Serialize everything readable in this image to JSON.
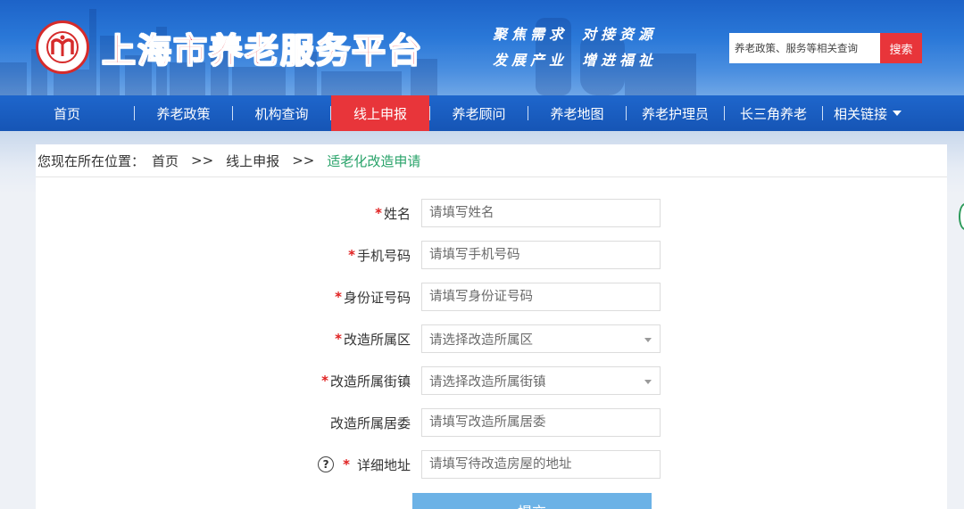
{
  "header": {
    "site_title": "上海市养老服务平台",
    "slogan_line1": [
      "聚焦需求",
      "对接资源"
    ],
    "slogan_line2": [
      "发展产业",
      "增进福祉"
    ],
    "search_placeholder": "养老政策、服务等相关查询",
    "search_button": "搜索",
    "brand_color": "#e8222b"
  },
  "nav": {
    "items": [
      {
        "label": "首页",
        "active": false
      },
      {
        "label": "养老政策",
        "active": false
      },
      {
        "label": "机构查询",
        "active": false
      },
      {
        "label": "线上申报",
        "active": true
      },
      {
        "label": "养老顾问",
        "active": false
      },
      {
        "label": "养老地图",
        "active": false
      },
      {
        "label": "养老护理员",
        "active": false
      },
      {
        "label": "长三角养老",
        "active": false
      },
      {
        "label": "相关链接",
        "active": false
      }
    ],
    "active_color": "#e8353a"
  },
  "breadcrumb": {
    "prefix": "您现在所在位置：",
    "items": [
      "首页",
      "线上申报",
      "适老化改造申请"
    ],
    "separator": ">>"
  },
  "form": {
    "fields": [
      {
        "label": "姓名",
        "required": true,
        "type": "input",
        "placeholder": "请填写姓名"
      },
      {
        "label": "手机号码",
        "required": true,
        "type": "input",
        "placeholder": "请填写手机号码"
      },
      {
        "label": "身份证号码",
        "required": true,
        "type": "input",
        "placeholder": "请填写身份证号码"
      },
      {
        "label": "改造所属区",
        "required": true,
        "type": "select",
        "placeholder": "请选择改造所属区"
      },
      {
        "label": "改造所属街镇",
        "required": true,
        "type": "select",
        "placeholder": "请选择改造所属街镇"
      },
      {
        "label": "改造所属居委",
        "required": false,
        "type": "input",
        "placeholder": "请填写改造所属居委"
      },
      {
        "label": "详细地址",
        "required": true,
        "type": "input",
        "placeholder": "请填写待改造房屋的地址",
        "help": "?"
      }
    ],
    "required_mark": "*",
    "submit_label": "提交"
  }
}
